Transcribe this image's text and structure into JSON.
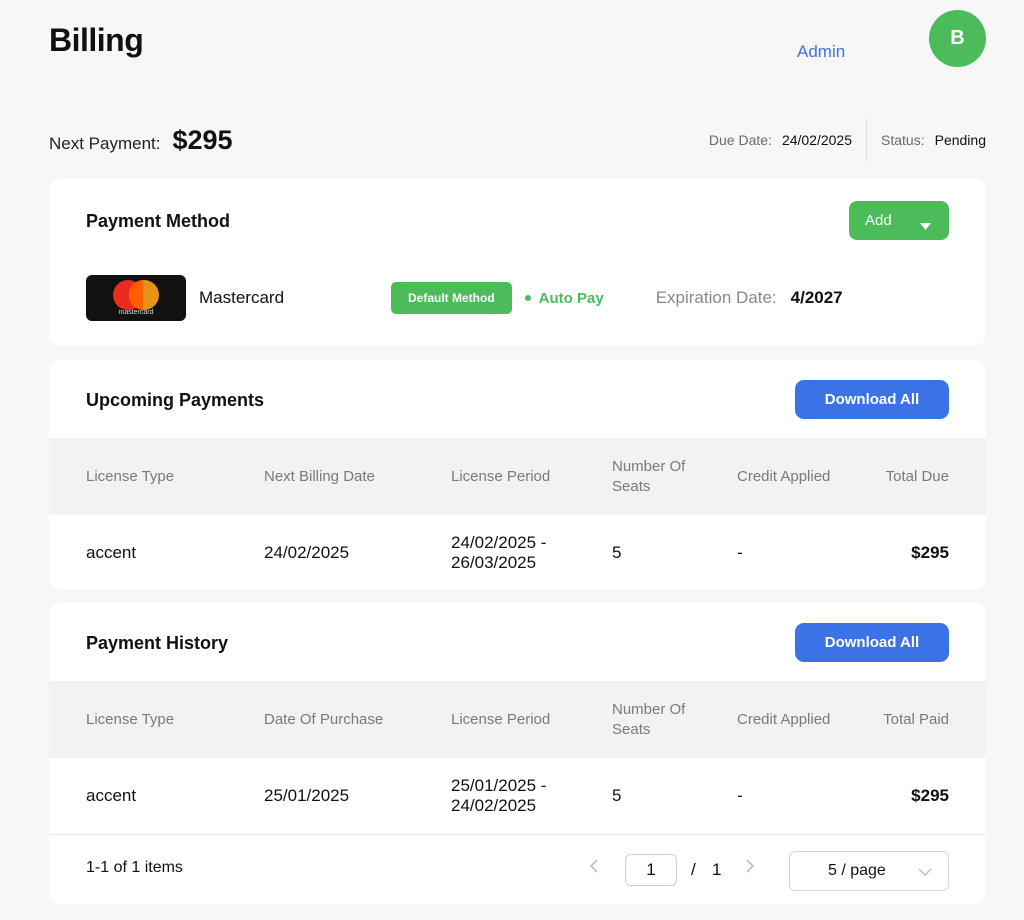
{
  "header": {
    "title": "Billing",
    "admin_label": "Admin",
    "avatar_initial": "B"
  },
  "summary": {
    "next_payment_label": "Next Payment:",
    "next_payment_amount": "$295",
    "due_date_label": "Due Date:",
    "due_date_value": "24/02/2025",
    "status_label": "Status:",
    "status_value": "Pending"
  },
  "payment_method": {
    "title": "Payment Method",
    "add_label": "Add",
    "card_logo_text": "mastercard",
    "card_name": "Mastercard",
    "default_badge": "Default Method",
    "autopay_label": "Auto Pay",
    "expiration_label": "Expiration Date:",
    "expiration_value": "4/2027"
  },
  "upcoming": {
    "title": "Upcoming Payments",
    "download_label": "Download All",
    "columns": [
      "License Type",
      "Next Billing Date",
      "License Period",
      "Number Of Seats",
      "Credit Applied",
      "Total Due"
    ],
    "rows": [
      [
        "accent",
        "24/02/2025",
        "24/02/2025 - 26/03/2025",
        "5",
        "-",
        "$295"
      ]
    ]
  },
  "history": {
    "title": "Payment History",
    "download_label": "Download All",
    "columns": [
      "License Type",
      "Date Of Purchase",
      "License Period",
      "Number Of Seats",
      "Credit Applied",
      "Total Paid"
    ],
    "rows": [
      [
        "accent",
        "25/01/2025",
        "25/01/2025 - 24/02/2025",
        "5",
        "-",
        "$295"
      ]
    ]
  },
  "pagination": {
    "items_text": "1-1 of 1 items",
    "current_page": "1",
    "separator": "/",
    "total_pages": "1",
    "page_size": "5 / page"
  },
  "colors": {
    "green": "#4cbb5a",
    "blue": "#3b73e6",
    "background": "#f7f7f7"
  },
  "icons": [
    "chevron-left-icon",
    "chevron-right-icon",
    "chevron-down-icon",
    "caret-down-icon",
    "status-dot-icon",
    "mastercard-logo-icon"
  ]
}
